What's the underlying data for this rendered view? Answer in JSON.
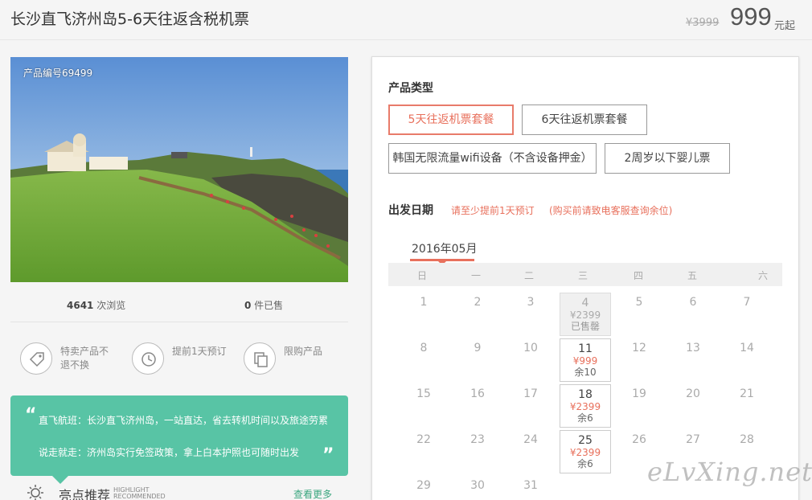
{
  "header": {
    "title": "长沙直飞济州岛5-6天往返含税机票",
    "original_price": "¥3999",
    "price": "999",
    "price_unit": "元起"
  },
  "photo": {
    "code_label": "产品编号69499"
  },
  "stats": {
    "views_count": "4641",
    "views_label": " 次浏览",
    "sold_count": "0",
    "sold_label": " 件已售"
  },
  "features": [
    {
      "text": "特卖产品不退不换",
      "icon": "tag-icon"
    },
    {
      "text": "提前1天预订",
      "icon": "clock-icon"
    },
    {
      "text": "限购产品",
      "icon": "copy-icon"
    }
  ],
  "quote": {
    "line1": "直飞航班：长沙直飞济州岛，一站直达，省去转机时间以及旅途劳累",
    "line2": "说走就走：济州岛实行免签政策，拿上白本护照也可随时出发"
  },
  "highlight": {
    "title": "亮点推荐",
    "en_line1": "HIGHLIGHT",
    "en_line2": "RECOMMENDED",
    "more": "查看更多"
  },
  "booking": {
    "type_label": "产品类型",
    "options": [
      "5天往返机票套餐",
      "6天往返机票套餐",
      "韩国无限流量wifi设备（不含设备押金）",
      "2周岁以下婴儿票"
    ],
    "date_label": "出发日期",
    "note1": "请至少提前1天预订",
    "note2": "(购买前请致电客服查询余位)",
    "month": "2016年05月",
    "weekdays": [
      "日",
      "一",
      "二",
      "三",
      "四",
      "五",
      "六"
    ],
    "weeks": [
      [
        "1",
        "2",
        "3",
        "4",
        "5",
        "6",
        "7"
      ],
      [
        "8",
        "9",
        "10",
        "11",
        "12",
        "13",
        "14"
      ],
      [
        "15",
        "16",
        "17",
        "18",
        "19",
        "20",
        "21"
      ],
      [
        "22",
        "23",
        "24",
        "25",
        "26",
        "27",
        "28"
      ],
      [
        "29",
        "30",
        "31",
        "",
        "",
        "",
        ""
      ]
    ],
    "available": [
      {
        "day": "4",
        "price": "¥2399",
        "remain": "已售罄"
      },
      {
        "day": "11",
        "price": "¥999",
        "remain": "余10"
      },
      {
        "day": "18",
        "price": "¥2399",
        "remain": "余6"
      },
      {
        "day": "25",
        "price": "¥2399",
        "remain": "余6"
      }
    ]
  },
  "watermark": "eLvXing.net",
  "colors": {
    "accent": "#e8705c",
    "green": "#58c4a5"
  }
}
